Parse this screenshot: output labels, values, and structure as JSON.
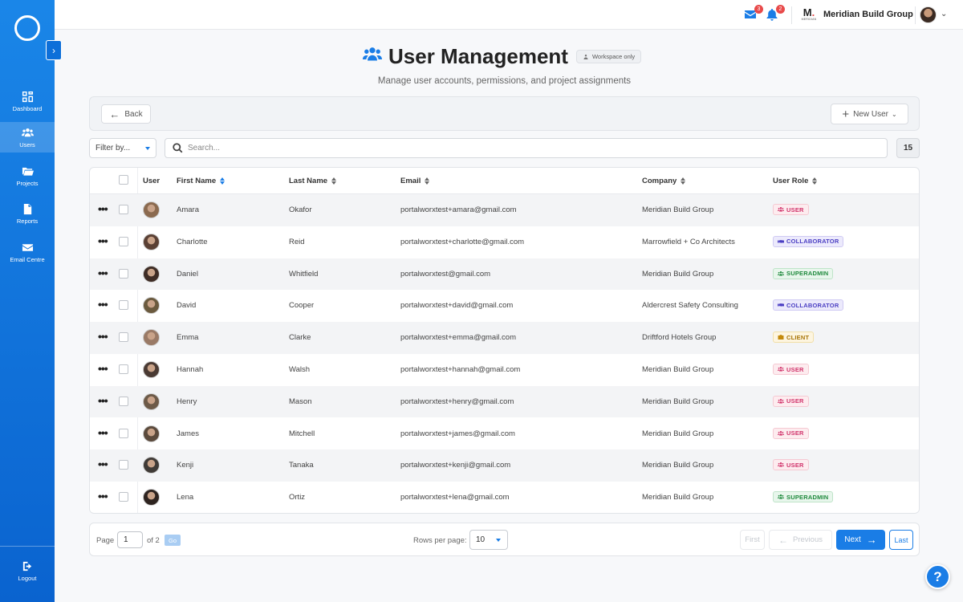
{
  "sidebar": {
    "items": [
      {
        "label": "Dashboard",
        "icon": "dashboard-icon"
      },
      {
        "label": "Users",
        "icon": "users-icon"
      },
      {
        "label": "Projects",
        "icon": "folder-icon"
      },
      {
        "label": "Reports",
        "icon": "file-icon"
      },
      {
        "label": "Email Centre",
        "icon": "envelope-icon"
      }
    ],
    "logout_label": "Logout"
  },
  "header": {
    "mail_count": "3",
    "notification_count": "2",
    "company_logo_text": "MERIDIAN",
    "company_name": "Meridian Build Group"
  },
  "page": {
    "title": "User Management",
    "workspace_chip": "Workspace only",
    "subtitle": "Manage user accounts, permissions, and project assignments"
  },
  "actions": {
    "back_label": "Back",
    "new_user_label": "New User"
  },
  "filter": {
    "placeholder": "Filter by...",
    "search_placeholder": "Search...",
    "result_count": "15"
  },
  "table": {
    "headers": {
      "user": "User",
      "first_name": "First Name",
      "last_name": "Last Name",
      "email": "Email",
      "company": "Company",
      "role": "User Role"
    },
    "rows": [
      {
        "first": "Amara",
        "last": "Okafor",
        "email": "portalworxtest+amara@gmail.com",
        "company": "Meridian Build Group",
        "role": "USER"
      },
      {
        "first": "Charlotte",
        "last": "Reid",
        "email": "portalworxtest+charlotte@gmail.com",
        "company": "Marrowfield + Co Architects",
        "role": "COLLABORATOR"
      },
      {
        "first": "Daniel",
        "last": "Whitfield",
        "email": "portalworxtest@gmail.com",
        "company": "Meridian Build Group",
        "role": "SUPERADMIN"
      },
      {
        "first": "David",
        "last": "Cooper",
        "email": "portalworxtest+david@gmail.com",
        "company": "Aldercrest Safety Consulting",
        "role": "COLLABORATOR"
      },
      {
        "first": "Emma",
        "last": "Clarke",
        "email": "portalworxtest+emma@gmail.com",
        "company": "Driftford Hotels Group",
        "role": "CLIENT"
      },
      {
        "first": "Hannah",
        "last": "Walsh",
        "email": "portalworxtest+hannah@gmail.com",
        "company": "Meridian Build Group",
        "role": "USER"
      },
      {
        "first": "Henry",
        "last": "Mason",
        "email": "portalworxtest+henry@gmail.com",
        "company": "Meridian Build Group",
        "role": "USER"
      },
      {
        "first": "James",
        "last": "Mitchell",
        "email": "portalworxtest+james@gmail.com",
        "company": "Meridian Build Group",
        "role": "USER"
      },
      {
        "first": "Kenji",
        "last": "Tanaka",
        "email": "portalworxtest+kenji@gmail.com",
        "company": "Meridian Build Group",
        "role": "USER"
      },
      {
        "first": "Lena",
        "last": "Ortiz",
        "email": "portalworxtest+lena@gmail.com",
        "company": "Meridian Build Group",
        "role": "SUPERADMIN"
      }
    ]
  },
  "pagination": {
    "page_label": "Page",
    "current_page": "1",
    "of_label": "of 2",
    "go_label": "Go",
    "rows_per_page_label": "Rows per page:",
    "rows_per_page": "10",
    "first_label": "First",
    "previous_label": "Previous",
    "next_label": "Next",
    "last_label": "Last"
  },
  "help_label": "?",
  "colors": {
    "accent": "#1a7de6",
    "role_user": "#d1336b",
    "role_collaborator": "#4b3fc3",
    "role_superadmin": "#1f8a3d",
    "role_client": "#a8760a"
  }
}
